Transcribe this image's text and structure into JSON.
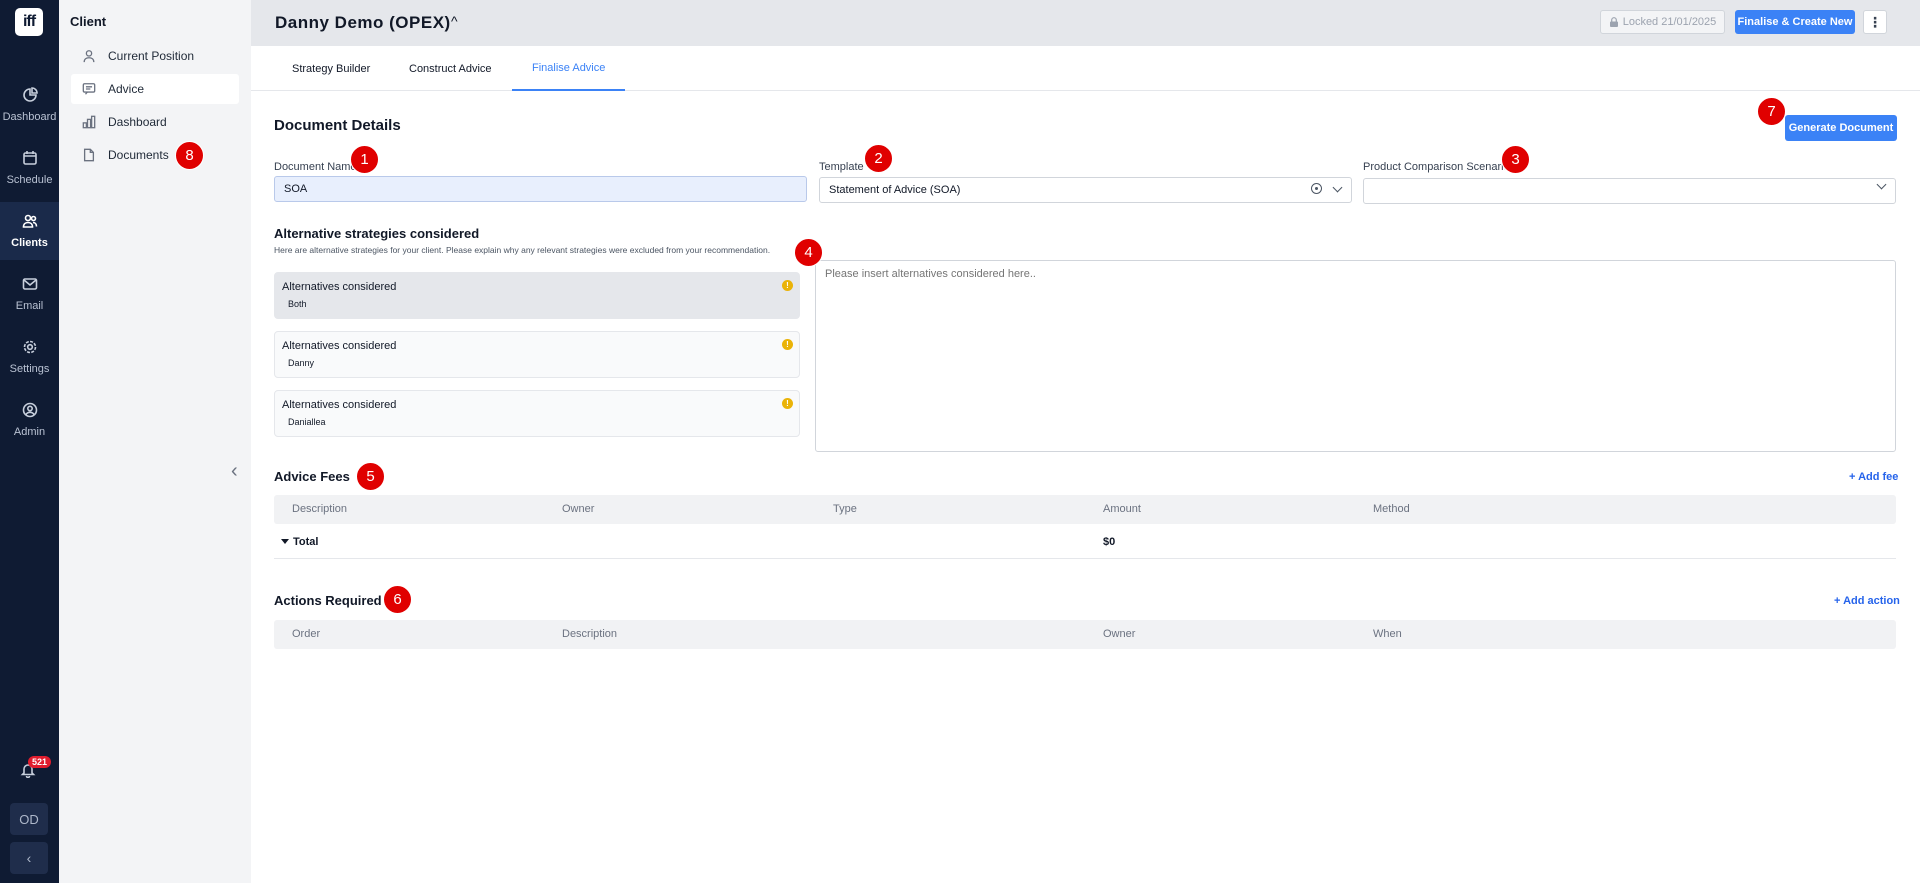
{
  "brand": {
    "logo_text": "iff"
  },
  "rail": {
    "items": [
      {
        "label": "Dashboard",
        "icon": "pie-chart-icon"
      },
      {
        "label": "Schedule",
        "icon": "calendar-icon"
      },
      {
        "label": "Clients",
        "icon": "users-icon",
        "active": true
      },
      {
        "label": "Email",
        "icon": "mail-icon"
      },
      {
        "label": "Settings",
        "icon": "gear-icon"
      },
      {
        "label": "Admin",
        "icon": "user-circle-icon"
      }
    ],
    "notifications_count": "521",
    "avatar_initials": "OD",
    "collapse_glyph": "‹"
  },
  "panel": {
    "title": "Client",
    "items": [
      {
        "label": "Current Position",
        "icon": "person-icon"
      },
      {
        "label": "Advice",
        "icon": "chat-icon",
        "active": true
      },
      {
        "label": "Dashboard",
        "icon": "bar-chart-icon"
      },
      {
        "label": "Documents",
        "icon": "document-icon"
      }
    ],
    "collapse_glyph": "‹"
  },
  "header": {
    "client_name": "Danny Demo (OPEX)",
    "caret": "^",
    "locked_label": "Locked 21/01/2025",
    "finalise_label": "Finalise & Create New",
    "more_glyph": "⋮"
  },
  "tabs": [
    {
      "label": "Strategy Builder"
    },
    {
      "label": "Construct Advice"
    },
    {
      "label": "Finalise Advice",
      "active": true
    }
  ],
  "document_details": {
    "title": "Document Details",
    "generate_label": "Generate Document",
    "document_name": {
      "label": "Document Name",
      "value": "SOA"
    },
    "template": {
      "label": "Template",
      "value": "Statement of Advice (SOA)"
    },
    "product_comparison": {
      "label": "Product Comparison Scenarios",
      "value": ""
    }
  },
  "alternatives": {
    "title": "Alternative strategies considered",
    "description": "Here are alternative strategies for your client. Please explain why any relevant strategies were excluded from your recommendation.",
    "cards": [
      {
        "title": "Alternatives considered",
        "subtitle": "Both",
        "warn": "!"
      },
      {
        "title": "Alternatives considered",
        "subtitle": "Danny",
        "warn": "!"
      },
      {
        "title": "Alternatives considered",
        "subtitle": "Daniallea",
        "warn": "!"
      }
    ],
    "placeholder": "Please insert alternatives considered here.."
  },
  "fees": {
    "title": "Advice Fees",
    "add_label": "+ Add fee",
    "columns": [
      "Description",
      "Owner",
      "Type",
      "Amount",
      "Method"
    ],
    "total_label": "Total",
    "total_amount": "$0"
  },
  "actions": {
    "title": "Actions Required",
    "add_label": "+ Add action",
    "columns": [
      "Order",
      "Description",
      "Owner",
      "When"
    ]
  },
  "markers": [
    "1",
    "2",
    "3",
    "4",
    "5",
    "6",
    "7",
    "8"
  ],
  "colors": {
    "accent": "#3b82f6",
    "rail": "#0f1b33",
    "marker": "#e00000",
    "warning": "#eab308"
  }
}
